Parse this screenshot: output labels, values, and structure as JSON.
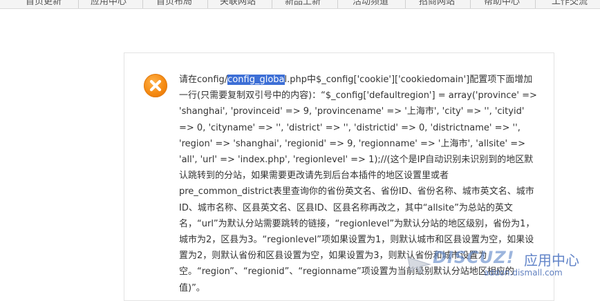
{
  "nav": {
    "tabs": [
      "首页更新",
      "应用中心",
      "首页布局",
      "关联网站",
      "新品上新",
      "活动频道",
      "招商网站",
      "帮助中心",
      "工作交流"
    ]
  },
  "message": {
    "prefix": "请在config/",
    "highlight": "config_globa",
    "rest": "l.php中$_config['cookie']['cookiedomain']配置项下面增加一行(只需要复制双引号中的内容)：“$_config['defaultregion'] = array('province' => 'shanghai', 'provinceid' => 9, 'provincename' => '上海市', 'city' => '', 'cityid' => 0, 'cityname' => '', 'district' => '', 'districtid' => 0, 'districtname' => '', 'region' => 'shanghai', 'regionid' => 9, 'regionname' => '上海市', 'allsite' => 'all', 'url' => 'index.php', 'regionlevel' => 1);//(这个是IP自动识别未识别到的地区默认跳转到的分站，如果需要更改请先到后台本插件的地区设置里或者pre_common_district表里查询你的省份英文名、省份ID、省份名称、城市英文名、城市ID、城市名称、区县英文名、区县ID、区县名称再改之，其中“allsite”为总站的英文名，“url”为默认分站需要跳转的链接，“regionlevel”为默认分站的地区级别，省份为1，城市为2，区县为3。“regionlevel”项如果设置为1，则默认城市和区县设置为空，如果设置为2，则默认省份和区县设置为空，如果设置为3，则默认省份和城市设置为空。“region”、“regionid”、“regionname”项设置为当前级别默认分站地区相应的值)”。"
  },
  "watermark": {
    "brand": "DISCUZ!",
    "cn": "应用中心",
    "url": "addon.dismall.com"
  },
  "colors": {
    "icon": "#f58a12",
    "highlight": "#3d6fd6",
    "text": "#333333"
  }
}
